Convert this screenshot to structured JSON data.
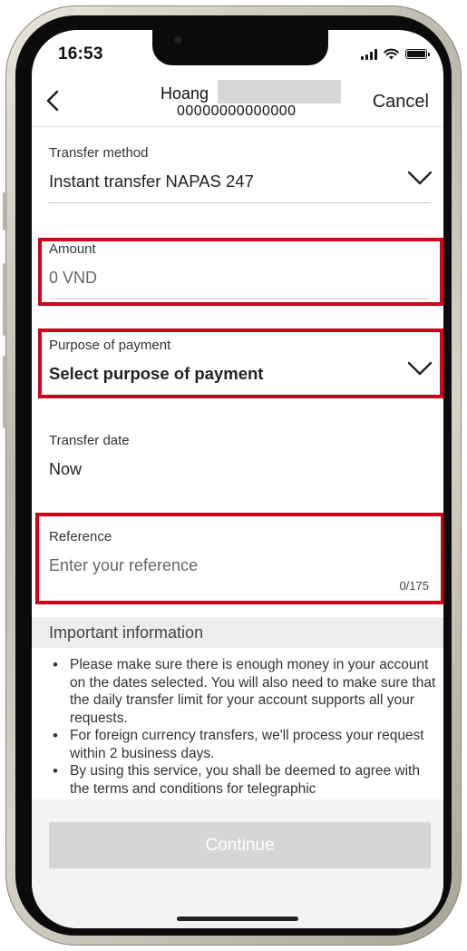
{
  "status_bar": {
    "time": "16:53"
  },
  "header": {
    "recipient_name": "Hoang",
    "account_number": "00000000000000",
    "cancel_label": "Cancel"
  },
  "form": {
    "transfer_method": {
      "label": "Transfer method",
      "value": "Instant transfer NAPAS 247"
    },
    "amount": {
      "label": "Amount",
      "placeholder": "0 VND"
    },
    "purpose": {
      "label": "Purpose of payment",
      "value": "Select purpose of payment"
    },
    "transfer_date": {
      "label": "Transfer date",
      "value": "Now"
    },
    "reference": {
      "label": "Reference",
      "placeholder": "Enter your reference",
      "counter": "0/175"
    }
  },
  "important_info": {
    "title": "Important information",
    "items": [
      "Please make sure there is enough money in your account on the dates selected. You will also need to make sure that the daily transfer limit for your account supports all your requests.",
      "For foreign currency transfers, we'll process your request within 2 business days.",
      "By using this service, you shall be deemed to agree with the terms and conditions for telegraphic"
    ]
  },
  "footer": {
    "continue_label": "Continue"
  },
  "colors": {
    "highlight": "#d0021b",
    "disabled_button": "#d6d6d6"
  },
  "icons": {
    "back": "chevron-left-icon",
    "dropdown": "chevron-down-icon",
    "signal": "cellular-signal-icon",
    "wifi": "wifi-icon",
    "battery": "battery-icon"
  }
}
